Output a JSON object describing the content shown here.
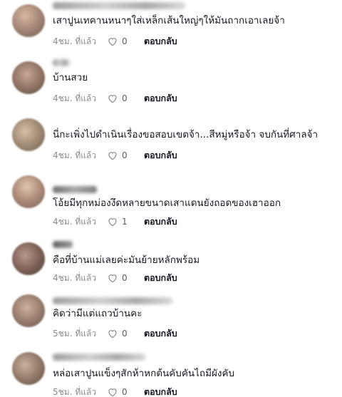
{
  "reply_label": "ตอบกลับ",
  "like_icon": "heart-outline-icon",
  "comments": [
    {
      "text": "เสาปูนเทคานหนาๆใส่เหล็กเส้นใหญ่ๆให้มันถากเอาเลยจ้า",
      "time": "4ชม. ที่แล้ว",
      "likes": "0"
    },
    {
      "text": "บ้านสวย",
      "time": "4ชม. ที่แล้ว",
      "likes": "0"
    },
    {
      "text": "นี่กะเพิ่งไปดำเนินเรื่องขอสอบเขตจ้า...สีหมู่หรือจ้า จบกันที่ศาลจ้า",
      "time": "4ชม. ที่แล้ว",
      "likes": "0"
    },
    {
      "text": "โอ้ยมีทุกหม่องงึดหลายขนาดเสาแดนยังถอดของเฮาออก",
      "time": "4ชม. ที่แล้ว",
      "likes": "1"
    },
    {
      "text": "คือที่บ้านแม่เลยค่ะมันย้ายหลักพร้อม",
      "time": "4ชม. ที่แล้ว",
      "likes": "0"
    },
    {
      "text": "คิดว่ามีแต่แถวบ้านคะ",
      "time": "5ชม. ที่แล้ว",
      "likes": "0"
    },
    {
      "text": "หล่อเสาปูนแข็งๆสักห้าหกต้นคับคันไถมีผังคับ",
      "time": "5ชม. ที่แล้ว",
      "likes": "0"
    }
  ]
}
